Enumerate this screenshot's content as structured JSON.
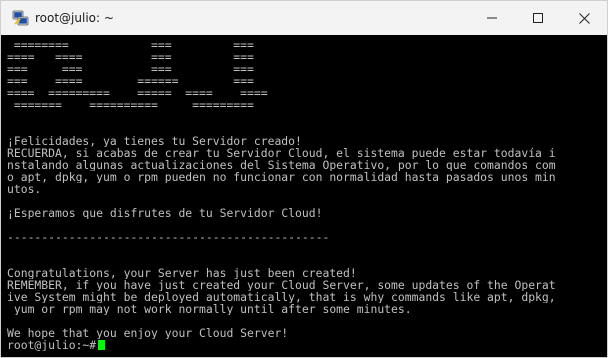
{
  "window": {
    "title": "root@julio: ~",
    "icon": "putty-icon",
    "controls": [
      "minimize-icon",
      "maximize-icon",
      "close-icon"
    ]
  },
  "terminal": {
    "banner": [
      " ========            ===         ===",
      "====   ====          ===         ===",
      "===     ===          ===         ===",
      "===    ====        ======        ===",
      "====  =========    =====  ====    ====",
      " =======    ==========     ========="
    ],
    "es_line1": "¡Felicidades, ya tienes tu Servidor creado!",
    "es_para": [
      "RECUERDA, si acabas de crear tu Servidor Cloud, el sistema puede estar todavía i",
      "nstalando algunas actualizaciones del Sistema Operativo, por lo que comandos com",
      "o apt, dpkg, yum o rpm pueden no funcionar con normalidad hasta pasados unos min",
      "utos."
    ],
    "es_enjoy": "¡Esperamos que disfrutes de tu Servidor Cloud!",
    "separator": "-----------------------------------------------",
    "en_line1": "Congratulations, your Server has just been created!",
    "en_para": [
      "REMEMBER, if you have just created your Cloud Server, some updates of the Operat",
      "ive System might be deployed automatically, that is why commands like apt, dpkg,",
      " yum or rpm may not work normally until after some minutes."
    ],
    "en_enjoy": "We hope that you enjoy your Cloud Server!",
    "prompt": "root@julio:~#",
    "cursor_color": "#00ff00"
  }
}
